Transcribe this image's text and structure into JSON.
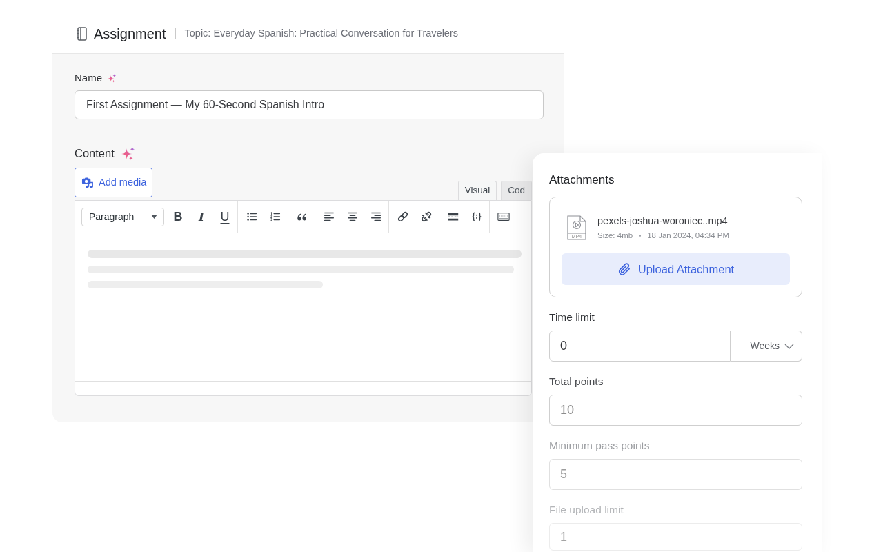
{
  "header": {
    "title": "Assignment",
    "topic": "Topic: Everyday Spanish: Practical Conversation for Travelers"
  },
  "name_field": {
    "label": "Name",
    "value": "First Assignment — My 60-Second Spanish Intro"
  },
  "content": {
    "label": "Content",
    "add_media_button": "Add media",
    "tabs": [
      {
        "label": "Visual",
        "selected": true
      },
      {
        "label": "Cod",
        "selected": false
      }
    ],
    "toolbar": {
      "format_select": "Paragraph",
      "text_style_buttons": [
        {
          "kind": "bold",
          "label": "B"
        },
        {
          "kind": "italic",
          "label": "I"
        },
        {
          "kind": "underline",
          "label": "U"
        }
      ]
    }
  },
  "attachments": {
    "title": "Attachments",
    "files": [
      {
        "name": "pexels-joshua-woroniec..mp4",
        "file_type": "MP4",
        "size": "Size: 4mb",
        "date": "18 Jan 2024, 04:34 PM"
      }
    ],
    "upload_button": "Upload Attachment"
  },
  "settings": [
    {
      "kind": "duration",
      "label": "Time limit",
      "value": "0",
      "unit": "Weeks"
    },
    {
      "kind": "number",
      "label": "Total points",
      "placeholder": "10"
    },
    {
      "kind": "number",
      "label": "Minimum pass points",
      "placeholder": "5"
    },
    {
      "kind": "number",
      "label": "File upload limit",
      "placeholder": "1"
    }
  ]
}
